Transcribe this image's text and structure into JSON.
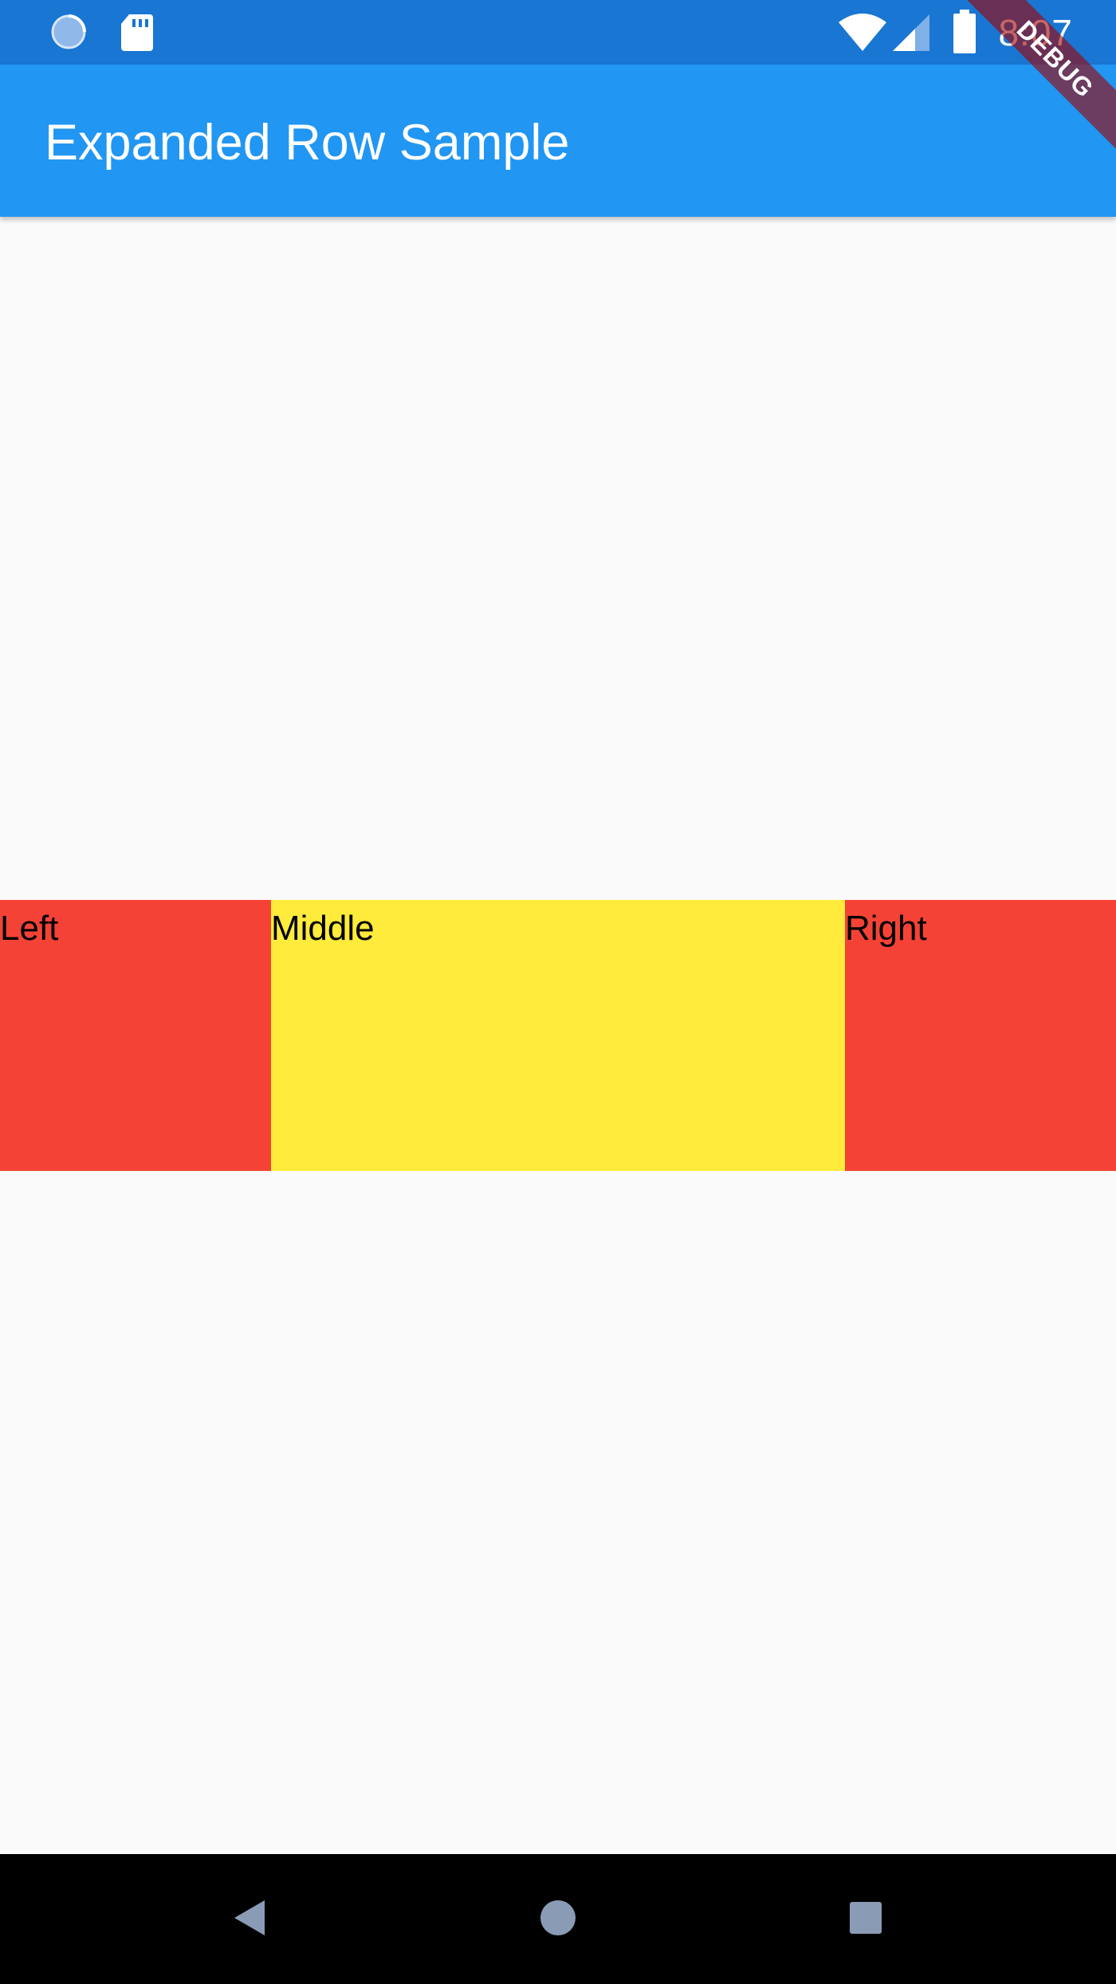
{
  "status_bar": {
    "time": "8:07",
    "left_icons": [
      "loading-circle-icon",
      "sd-card-icon"
    ],
    "right_icons": [
      "wifi-icon",
      "cell-signal-icon",
      "battery-icon"
    ]
  },
  "app_bar": {
    "title": "Expanded Row Sample"
  },
  "debug_banner": {
    "label": "DEBUG"
  },
  "row": {
    "items": [
      {
        "label": "Left",
        "color": "#f44336"
      },
      {
        "label": "Middle",
        "color": "#ffeb3b"
      },
      {
        "label": "Right",
        "color": "#f44336"
      }
    ]
  },
  "nav_bar": {
    "buttons": [
      "back-icon",
      "home-icon",
      "recents-icon"
    ]
  },
  "colors": {
    "status_bar": "#1976d2",
    "app_bar": "#2196f3",
    "background": "#fafafa",
    "nav_bar": "#000000"
  }
}
